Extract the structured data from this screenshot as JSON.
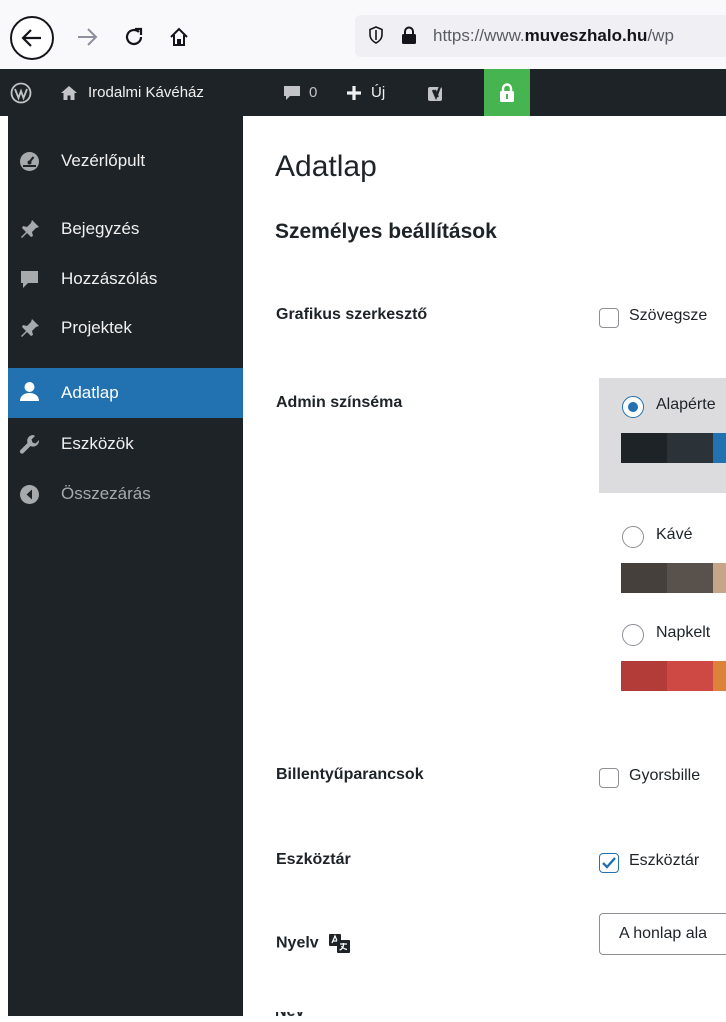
{
  "browser": {
    "url_prefix": "https://www.",
    "url_domain": "muveszhalo.hu",
    "url_suffix": "/wp"
  },
  "adminbar": {
    "site_name": "Irodalmi Kávéház",
    "comments_count": "0",
    "new_label": "Új"
  },
  "sidebar": {
    "items": [
      {
        "label": "Vezérlőpult",
        "icon": "dashboard-icon"
      },
      {
        "label": "Bejegyzés",
        "icon": "pin-icon"
      },
      {
        "label": "Hozzászólás",
        "icon": "comment-icon"
      },
      {
        "label": "Projektek",
        "icon": "pin-icon"
      },
      {
        "label": "Adatlap",
        "icon": "user-icon",
        "active": true
      },
      {
        "label": "Eszközök",
        "icon": "wrench-icon"
      },
      {
        "label": "Összezárás",
        "icon": "collapse-icon"
      }
    ]
  },
  "main": {
    "page_title": "Adatlap",
    "section_title": "Személyes beállítások",
    "visual_editor": {
      "label": "Grafikus szerkesztő",
      "option": "Szövegsze",
      "checked": false
    },
    "color_scheme": {
      "label": "Admin színséma",
      "schemes": [
        {
          "name": "Alapérte",
          "selected": true,
          "colors": [
            "#1d2327",
            "#2c3338",
            "#2271b1",
            "#72aee6"
          ]
        },
        {
          "name": "Kávé",
          "selected": false,
          "colors": [
            "#46403c",
            "#59524c",
            "#c7a589",
            "#9ea476"
          ]
        },
        {
          "name": "Napkelt",
          "selected": false,
          "colors": [
            "#b43c38",
            "#cf4944",
            "#dd823b",
            "#ccaf0b"
          ]
        }
      ]
    },
    "keyboard_shortcuts": {
      "label": "Billentyűparancsok",
      "option": "Gyorsbille",
      "checked": false
    },
    "toolbar": {
      "label": "Eszköztár",
      "option": "Eszköztár",
      "checked": true
    },
    "language": {
      "label": "Nyelv",
      "select_value": "A honlap ala"
    },
    "next_label": "Név"
  },
  "colors": {
    "admin_dark": "#1d2327",
    "accent": "#2271b1",
    "lock_green": "#46b450"
  }
}
